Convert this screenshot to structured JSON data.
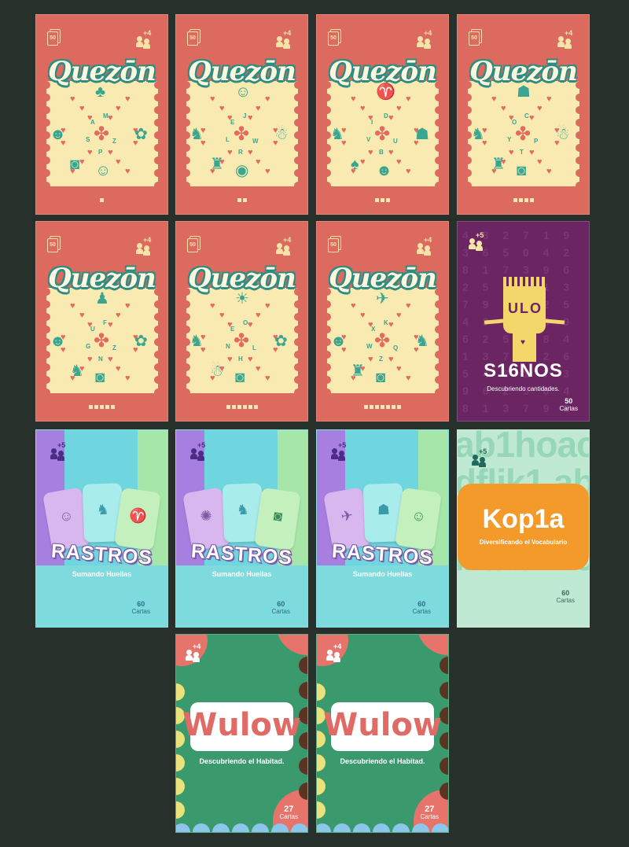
{
  "quezon": {
    "title": "Quezōn",
    "deck_count": "50",
    "players": "+4",
    "cards": [
      {
        "letters": [
          "M",
          "A",
          "S",
          "P",
          "Z"
        ],
        "dots": 1
      },
      {
        "letters": [
          "J",
          "E",
          "L",
          "R",
          "W"
        ],
        "dots": 2
      },
      {
        "letters": [
          "D",
          "I",
          "V",
          "B",
          "U"
        ],
        "dots": 3
      },
      {
        "letters": [
          "C",
          "O",
          "Y",
          "T",
          "P"
        ],
        "dots": 4
      },
      {
        "letters": [
          "F",
          "U",
          "G",
          "N",
          "Z"
        ],
        "dots": 5
      },
      {
        "letters": [
          "O",
          "E",
          "N",
          "H",
          "L"
        ],
        "dots": 6
      },
      {
        "letters": [
          "K",
          "X",
          "W",
          "Z",
          "Q"
        ],
        "dots": 7
      }
    ]
  },
  "signos": {
    "title": "S16NOS",
    "subtitle": "Descubriendo cantidades.",
    "count": "50",
    "count_label": "Cartas",
    "players": "+5",
    "face": "ULO",
    "pattern": "4 8 2 7 1 9 3 6 5 0 4 2 8 1 7 3 9 6 2 5 8 4 1 3 7 9 6 0 2 5 4 8 1 7 3 9 6 2 5 0 8 4 1 3 7 9 2 6 5 4 8 1 7 3 9 6 2 5 0 4 8 1 3 7 9 2 6 5 4 8 1 7 3 9 6 2 5 0 4 8 1 3 7 9 2 6 5 4 8 1 7 3 9 6 2 5 0 4 8 1 3 7 9 2 6 5 4 8 1 7 3 9 6 2 5 0 4 8 1 3 7 9 2 6 5 4 8 1 7 3 9 6 2 5 0 4 8 1 3 7 9 2 6"
  },
  "rastros": {
    "title": "RASTROS",
    "subtitle": "Sumando Huellas",
    "count": "60",
    "count_label": "Cartas",
    "players": "+5",
    "variants": [
      {
        "icons": [
          "frog-icon",
          "bird-icon",
          "goat-icon"
        ]
      },
      {
        "icons": [
          "bug-icon",
          "bird-icon",
          "owl-icon"
        ]
      },
      {
        "icons": [
          "mosquito-icon",
          "ant-icon",
          "frog-icon"
        ]
      }
    ]
  },
  "kopia": {
    "title": "Kop1a",
    "subtitle": "Diversificando el Vocabulario",
    "count": "60",
    "count_label": "Cartas",
    "players": "+5",
    "bg_text": "ab1hoac dflik1 ab1hotrus lztab1ho"
  },
  "wulow": {
    "title": "Wulow",
    "subtitle": "Descubriendo el Habitad.",
    "count": "27",
    "count_label": "Cartas",
    "players": "+4"
  },
  "colors": {
    "quezon_bg": "#dc6a5f",
    "quezon_panel": "#f8eab0",
    "quezon_accent": "#3aa590",
    "signos_bg": "#6b2563",
    "signos_robot": "#f3d76b",
    "rastros_purple": "#a77fe0",
    "rastros_cyan": "#6fd6df",
    "rastros_green": "#a6e7a9",
    "kopia_bg": "#bfe9d2",
    "kopia_band": "#f39a2a",
    "wulow_bg": "#3b9a6d",
    "wulow_coral": "#e6746b"
  }
}
